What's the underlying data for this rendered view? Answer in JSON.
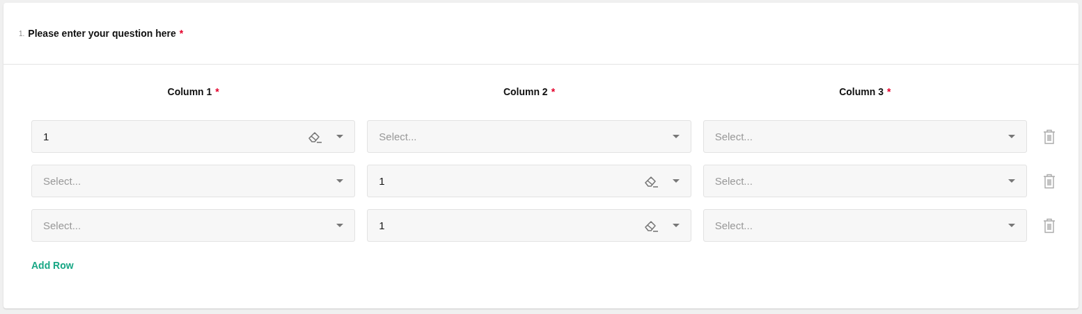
{
  "question": {
    "number": "1.",
    "text": "Please enter your question here",
    "required_mark": "*"
  },
  "columns": [
    {
      "label": "Column 1",
      "required_mark": "*"
    },
    {
      "label": "Column 2",
      "required_mark": "*"
    },
    {
      "label": "Column 3",
      "required_mark": "*"
    }
  ],
  "rows": [
    {
      "cells": [
        {
          "value": "1"
        },
        {
          "placeholder": "Select..."
        },
        {
          "placeholder": "Select..."
        }
      ]
    },
    {
      "cells": [
        {
          "placeholder": "Select..."
        },
        {
          "value": "1"
        },
        {
          "placeholder": "Select..."
        }
      ]
    },
    {
      "cells": [
        {
          "placeholder": "Select..."
        },
        {
          "value": "1"
        },
        {
          "placeholder": "Select..."
        }
      ]
    }
  ],
  "add_row": "Add Row"
}
